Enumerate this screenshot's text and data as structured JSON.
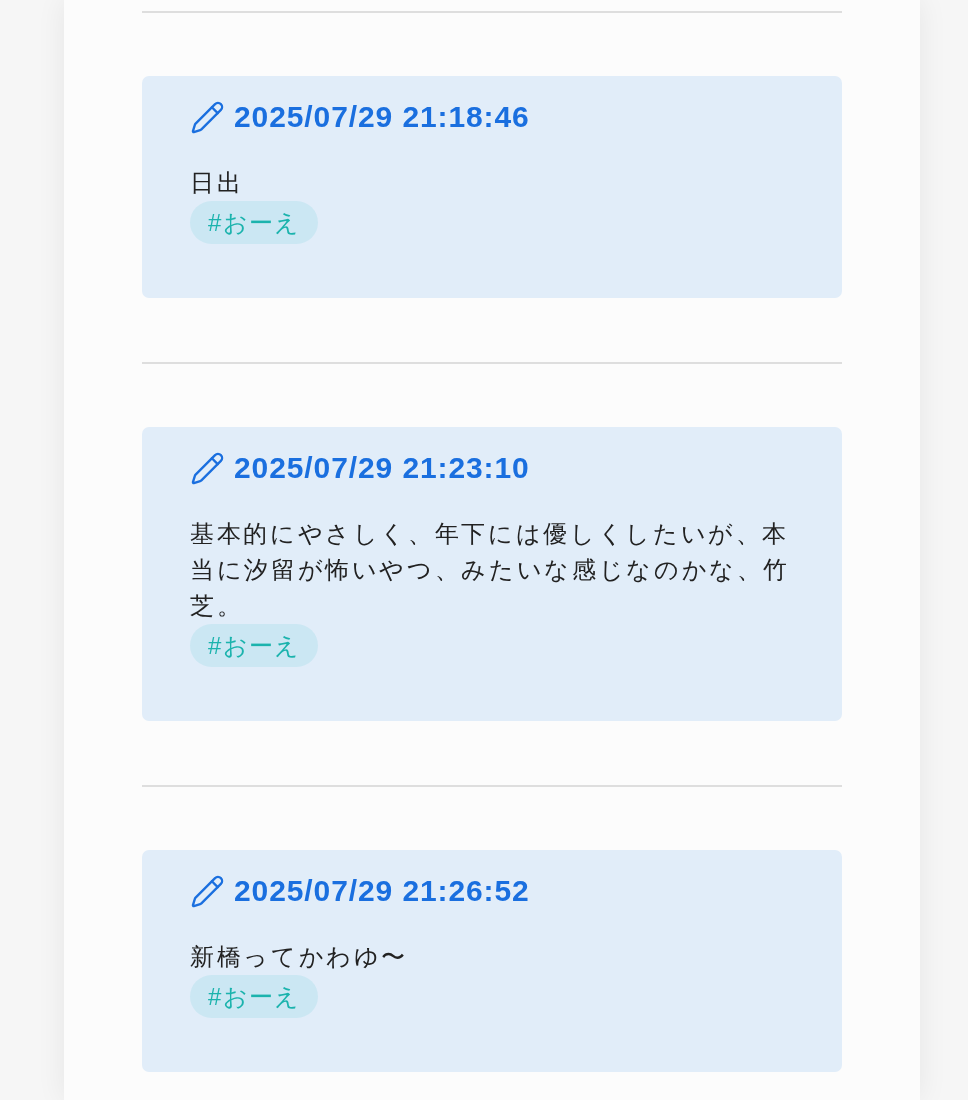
{
  "entries": [
    {
      "timestamp": "2025/07/29 21:18:46",
      "body": "日出",
      "tags": [
        "#おーえ"
      ]
    },
    {
      "timestamp": "2025/07/29 21:23:10",
      "body": "基本的にやさしく、年下には優しくしたいが、本当に汐留が怖いやつ、みたいな感じなのかな、竹芝。",
      "tags": [
        "#おーえ"
      ]
    },
    {
      "timestamp": "2025/07/29 21:26:52",
      "body": "新橋ってかわゆ〜",
      "tags": [
        "#おーえ"
      ]
    }
  ]
}
